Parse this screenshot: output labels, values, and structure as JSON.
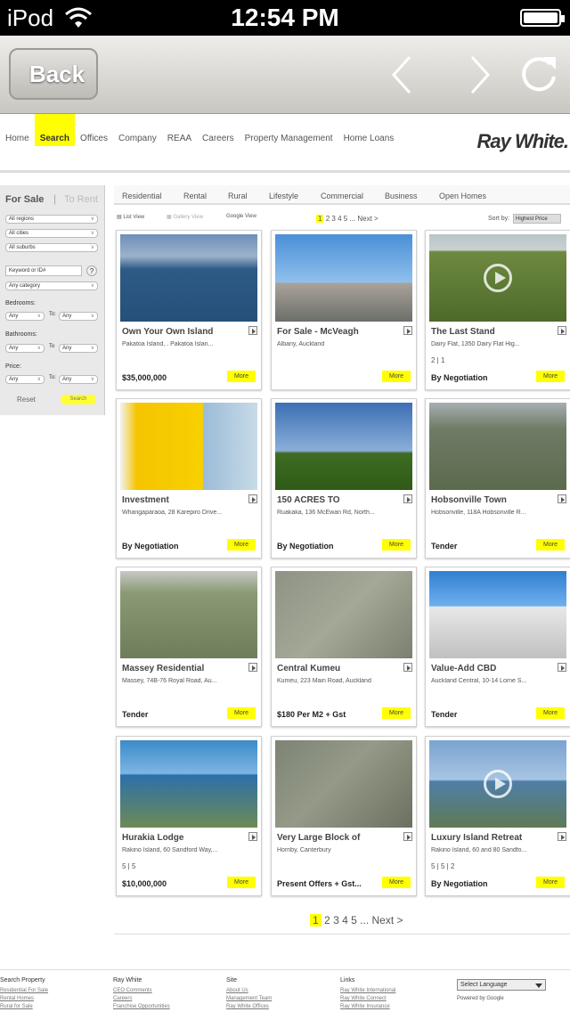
{
  "status": {
    "carrier": "iPod",
    "time": "12:54 PM"
  },
  "browser": {
    "back_label": "Back",
    "icons": [
      "chevron-left-icon",
      "chevron-right-icon",
      "reload-icon"
    ]
  },
  "site": {
    "menu": [
      "Home",
      "Search",
      "Offices",
      "Company",
      "REAA",
      "Careers",
      "Property Management",
      "Home Loans"
    ],
    "active_menu": "Search",
    "logo": "Ray White."
  },
  "sidebar": {
    "for_sale": "For Sale",
    "separator": "|",
    "to_rent": "To Rent",
    "regions": "All regions",
    "cities": "All cities",
    "suburbs": "All suburbs",
    "keyword_placeholder": "Keyword or ID#",
    "help": "?",
    "category": "Any category",
    "bedrooms_label": "Bedrooms:",
    "bathrooms_label": "Bathrooms:",
    "price_label": "Price:",
    "any": "Any",
    "to": "To:",
    "to_short": "To",
    "reset": "Reset",
    "search": "Search"
  },
  "categories": [
    "Residential",
    "Rental",
    "Rural",
    "Lifestyle",
    "Commercial",
    "Business",
    "Open Homes"
  ],
  "views": [
    "List View",
    "Gallery View",
    "Google View"
  ],
  "pager": {
    "pages": [
      "1",
      "2",
      "3",
      "4",
      "5"
    ],
    "ellipsis": "...",
    "next": "Next >",
    "current": "1"
  },
  "sort": {
    "label": "Sort by:",
    "value": "Highest Price"
  },
  "more_label": "More",
  "listings": [
    {
      "title": "Own Your Own Island",
      "address": "Pakatoa Island, . Pakatoa Islan...",
      "price": "$35,000,000",
      "features": "",
      "video": false,
      "thumb": "island"
    },
    {
      "title": "For Sale - McVeagh",
      "address": "Albany, Auckland",
      "price": "",
      "features": "",
      "video": false,
      "thumb": "building"
    },
    {
      "title": "The Last Stand",
      "address": "Dairy Flat, 1350 Dairy Flat Hig...",
      "price": "By Negotiation",
      "features": "2 | 1",
      "video": true,
      "thumb": "farm"
    },
    {
      "title": "Investment",
      "address": "Whangaparaoa, 28 Karepiro Drive...",
      "price": "By Negotiation",
      "features": "",
      "video": false,
      "thumb": "warehouse"
    },
    {
      "title": "150 ACRES TO",
      "address": "Ruakaka, 136 McEwan Rd, North...",
      "price": "By Negotiation",
      "features": "",
      "video": false,
      "thumb": "field"
    },
    {
      "title": "Hobsonville Town",
      "address": "Hobsonville, 118A Hobsonville R...",
      "price": "Tender",
      "features": "",
      "video": false,
      "thumb": "aerial"
    },
    {
      "title": "Massey Residential",
      "address": "Massey, 74B-76 Royal Road, Au...",
      "price": "Tender",
      "features": "",
      "video": false,
      "thumb": "suburb"
    },
    {
      "title": "Central Kumeu",
      "address": "Kumeu, 223 Main Road, Auckland",
      "price": "$180 Per M2 + Gst",
      "features": "",
      "video": false,
      "thumb": "map"
    },
    {
      "title": "Value-Add CBD",
      "address": "Auckland Central, 10-14 Lorne S...",
      "price": "Tender",
      "features": "",
      "video": false,
      "thumb": "tower"
    },
    {
      "title": "Hurakia Lodge",
      "address": "Rakino Island, 60 Sandford Way,...",
      "price": "$10,000,000",
      "features": "5 | 5",
      "video": false,
      "thumb": "lodge"
    },
    {
      "title": "Very Large Block of",
      "address": "Hornby, Canterbury",
      "price": "Present Offers + Gst...",
      "features": "",
      "video": false,
      "thumb": "block"
    },
    {
      "title": "Luxury Island Retreat",
      "address": "Rakino Island, 60 and 80 Sandfo...",
      "price": "By Negotiation",
      "features": "5 | 5 | 2",
      "video": true,
      "thumb": "retreat"
    }
  ],
  "footer": {
    "columns": [
      {
        "title": "Search Property",
        "links": [
          "Residential For Sale",
          "Rental Homes",
          "Rural for Sale"
        ]
      },
      {
        "title": "Ray White",
        "links": [
          "CEO Comments",
          "Careers",
          "Franchise Opportunities"
        ]
      },
      {
        "title": "Site",
        "links": [
          "About Us",
          "Management Team",
          "Ray White Offices"
        ]
      },
      {
        "title": "Links",
        "links": [
          "Ray White International",
          "Ray White Connect",
          "Ray White Insurance"
        ]
      }
    ],
    "language": "Select Language",
    "powered": "Powered by Google"
  }
}
